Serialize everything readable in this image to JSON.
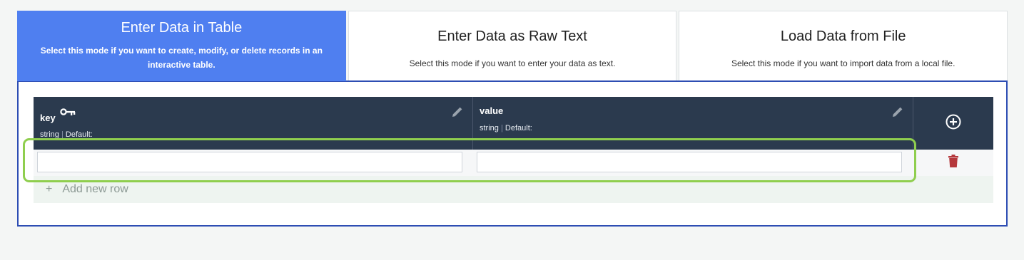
{
  "tabs": [
    {
      "title": "Enter Data in Table",
      "description": "Select this mode if you want to create, modify, or delete records in an interactive table.",
      "active": true
    },
    {
      "title": "Enter Data as Raw Text",
      "description": "Select this mode if you want to enter your data as text.",
      "active": false
    },
    {
      "title": "Load Data from File",
      "description": "Select this mode if you want to import data from a local file.",
      "active": false
    }
  ],
  "table": {
    "columns": [
      {
        "name": "key",
        "type": "string",
        "separator": "|",
        "default_label": "Default:",
        "icon": "key-icon"
      },
      {
        "name": "value",
        "type": "string",
        "separator": "|",
        "default_label": "Default:"
      }
    ],
    "rows": [
      {
        "key": "",
        "value": ""
      }
    ],
    "add_row_label": "Add new row",
    "add_row_symbol": "+"
  },
  "colors": {
    "active_tab": "#4f7ff0",
    "header_bg": "#2b3a4e",
    "panel_border": "#2d4db3",
    "highlight": "#8fce4e",
    "delete": "#b5383c"
  }
}
